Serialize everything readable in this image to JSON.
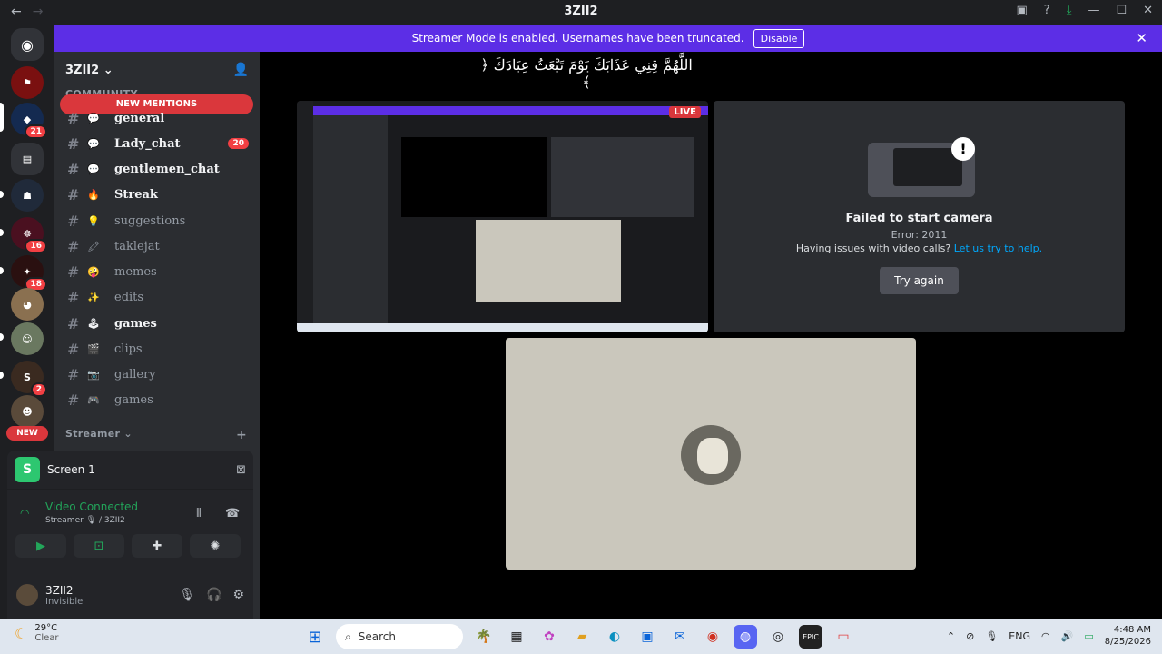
{
  "window": {
    "title": "3ZII2"
  },
  "banner": {
    "text": "Streamer Mode is enabled. Usernames have been truncated.",
    "disable_label": "Disable"
  },
  "rail": {
    "servers": [
      {
        "badge": "21"
      },
      {
        "badge": ""
      },
      {
        "badge": "16"
      },
      {
        "badge": "18"
      },
      {
        "badge": ""
      },
      {
        "badge": ""
      },
      {
        "badge": "2"
      }
    ],
    "new_label": "NEW"
  },
  "sidebar": {
    "server_name": "3ZII2",
    "new_mentions": "NEW MENTIONS",
    "category_community": "COMMUNITY",
    "category_streamer": "Streamer",
    "channels": [
      {
        "name": "general",
        "emoji": "💬",
        "unread": true,
        "count": ""
      },
      {
        "name": "Lady_chat",
        "emoji": "💬",
        "unread": true,
        "count": "20"
      },
      {
        "name": "gentlemen_chat",
        "emoji": "💬",
        "unread": true,
        "count": ""
      },
      {
        "name": "Streak",
        "emoji": "🔥",
        "unread": true,
        "count": ""
      },
      {
        "name": "suggestions",
        "emoji": "💡",
        "unread": false,
        "count": ""
      },
      {
        "name": "taklejat",
        "emoji": "🖍",
        "unread": false,
        "count": ""
      },
      {
        "name": "memes",
        "emoji": "🤪",
        "unread": false,
        "count": ""
      },
      {
        "name": "edits",
        "emoji": "✨",
        "unread": false,
        "count": ""
      },
      {
        "name": "games",
        "emoji": "🕹",
        "unread": true,
        "count": ""
      },
      {
        "name": "clips",
        "emoji": "🎬",
        "unread": false,
        "count": ""
      },
      {
        "name": "gallery",
        "emoji": "📷",
        "unread": false,
        "count": ""
      },
      {
        "name": "games",
        "emoji": "🎮",
        "unread": false,
        "count": ""
      }
    ]
  },
  "voice": {
    "screen_label": "Screen 1",
    "status": "Video Connected",
    "sub": "Streamer 🎙 / 3ZII2"
  },
  "user": {
    "name": "3ZII2",
    "status": "Invisible"
  },
  "stage": {
    "quran_text": "﴿ اللَّهُمَّ قِنِي عَذَابَكَ يَوْمَ تَبْعَثُ عِبَادَكَ ﴾",
    "live_label": "LIVE",
    "camera": {
      "title": "Failed to start camera",
      "error": "Error: 2011",
      "help_text": "Having issues with video calls?",
      "help_link": "Let us try to help.",
      "try_again": "Try again"
    }
  },
  "taskbar": {
    "temp": "29°C",
    "weather": "Clear",
    "search_placeholder": "Search",
    "lang": "ENG",
    "time": "4:48 AM",
    "date": "8/25/2026"
  },
  "colors": {
    "blurple": "#5c2ee6",
    "red": "#da373c",
    "green": "#23a55a",
    "link": "#00a8fc"
  }
}
